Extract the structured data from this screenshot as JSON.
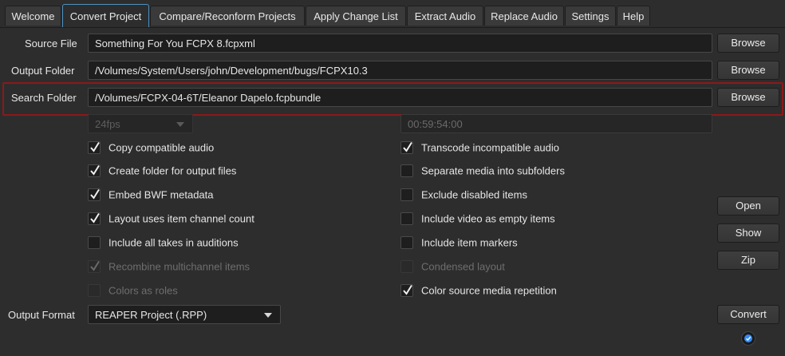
{
  "tabs": [
    {
      "label": "Welcome",
      "active": false
    },
    {
      "label": "Convert Project",
      "active": true
    },
    {
      "label": "Compare/Reconform Projects",
      "active": false
    },
    {
      "label": "Apply Change List",
      "active": false
    },
    {
      "label": "Extract Audio",
      "active": false
    },
    {
      "label": "Replace Audio",
      "active": false
    },
    {
      "label": "Settings",
      "active": false
    },
    {
      "label": "Help",
      "active": false
    }
  ],
  "source": {
    "label": "Source File",
    "value": "Something For You FCPX 8.fcpxml",
    "button": "Browse"
  },
  "output": {
    "label": "Output Folder",
    "value": "/Volumes/System/Users/john/Development/bugs/FCPX10.3",
    "button": "Browse"
  },
  "search": {
    "label": "Search Folder",
    "value": "/Volumes/FCPX-04-6T/Eleanor Dapelo.fcpbundle",
    "button": "Browse"
  },
  "framerate": {
    "value": "24fps"
  },
  "timecode": {
    "value": "00:59:54:00"
  },
  "checkboxes_left": [
    {
      "label": "Copy compatible audio",
      "checked": true,
      "disabled": false
    },
    {
      "label": "Create folder for output files",
      "checked": true,
      "disabled": false
    },
    {
      "label": "Embed BWF metadata",
      "checked": true,
      "disabled": false
    },
    {
      "label": "Layout uses item channel count",
      "checked": true,
      "disabled": false
    },
    {
      "label": "Include all takes in auditions",
      "checked": false,
      "disabled": false
    },
    {
      "label": "Recombine multichannel items",
      "checked": true,
      "disabled": true
    },
    {
      "label": "Colors as roles",
      "checked": false,
      "disabled": true
    }
  ],
  "checkboxes_right": [
    {
      "label": "Transcode incompatible audio",
      "checked": true,
      "disabled": false
    },
    {
      "label": "Separate media into subfolders",
      "checked": false,
      "disabled": false
    },
    {
      "label": "Exclude disabled items",
      "checked": false,
      "disabled": false
    },
    {
      "label": "Include video as empty items",
      "checked": false,
      "disabled": false
    },
    {
      "label": "Include item markers",
      "checked": false,
      "disabled": false
    },
    {
      "label": "Condensed layout",
      "checked": false,
      "disabled": true
    },
    {
      "label": "Color source media repetition",
      "checked": true,
      "disabled": false
    }
  ],
  "side_buttons": {
    "open": "Open",
    "show": "Show",
    "zip": "Zip",
    "convert": "Convert"
  },
  "output_format": {
    "label": "Output Format",
    "value": "REAPER Project (.RPP)"
  },
  "colors": {
    "accent": "#4d8fbf",
    "highlight": "#8b1a1a",
    "status": "#2f8cff"
  }
}
